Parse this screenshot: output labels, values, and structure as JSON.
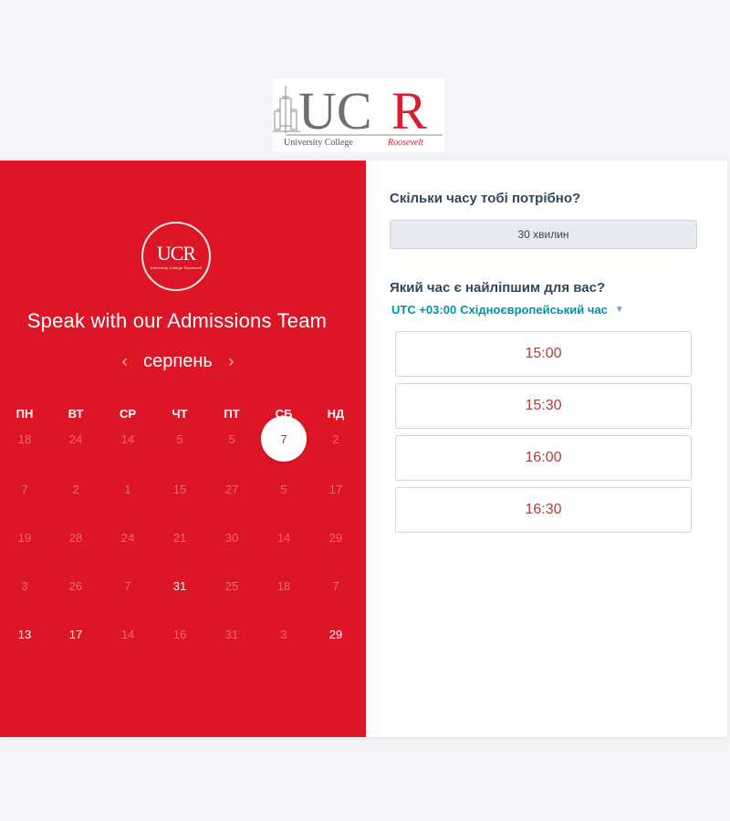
{
  "brand": {
    "logo_text": "UCR",
    "logo_subtitle_left": "University College",
    "logo_subtitle_right": "Roosevelt"
  },
  "calendar": {
    "title": "Speak with our Admissions Team",
    "month": "серпень",
    "prev_icon": "chevron-left-icon",
    "next_icon": "chevron-right-icon",
    "weekdays": [
      "ПН",
      "ВТ",
      "СР",
      "ЧТ",
      "ПТ",
      "СБ",
      "НД"
    ],
    "rows": [
      [
        "18",
        "24",
        "14",
        "5",
        "5",
        "7",
        "2"
      ],
      [
        "7",
        "2",
        "1",
        "15",
        "27",
        "5",
        "17"
      ],
      [
        "19",
        "28",
        "24",
        "21",
        "30",
        "14",
        "29"
      ],
      [
        "3",
        "26",
        "7",
        "31",
        "25",
        "18",
        "7"
      ],
      [
        "13",
        "17",
        "14",
        "16",
        "31",
        "3",
        "29"
      ]
    ],
    "available": [
      [
        3,
        3
      ],
      [
        4,
        0
      ],
      [
        4,
        1
      ],
      [
        4,
        6
      ]
    ],
    "selected": {
      "row": 0,
      "col": 5,
      "label": "7"
    }
  },
  "booking": {
    "duration_question": "Скільки часу тобі потрібно?",
    "duration_value": "30 хвилин",
    "time_question": "Який час є найліпшим для вас?",
    "timezone_offset": "UTC +03:00",
    "timezone_name": "Східноєвропейський час",
    "slots": [
      "15:00",
      "15:30",
      "16:00",
      "16:30"
    ]
  },
  "colors": {
    "brand_red": "#dc1627",
    "link_teal": "#0091ae",
    "slot_text": "#b33a3a"
  }
}
